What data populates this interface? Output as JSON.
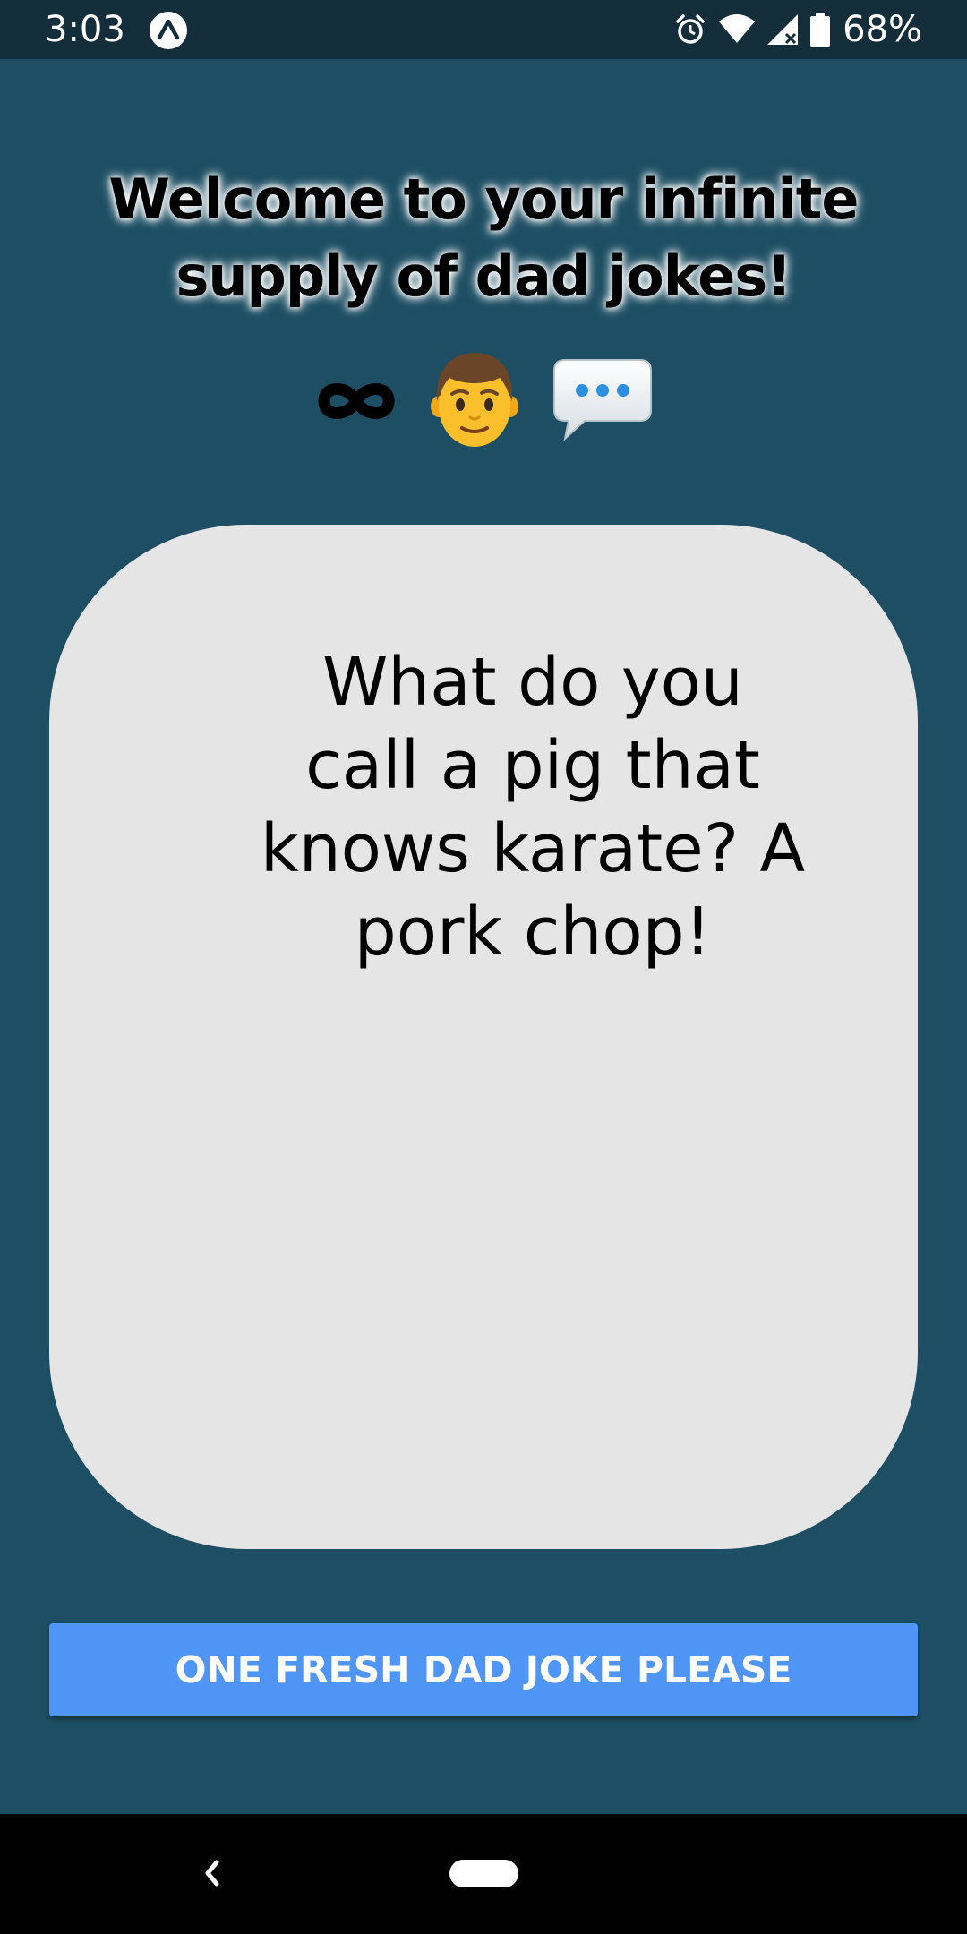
{
  "status_bar": {
    "time": "3:03",
    "battery_percent": "68%",
    "icons": [
      "expo-icon",
      "alarm-icon",
      "wifi-icon",
      "signal-icon",
      "battery-icon"
    ]
  },
  "header": {
    "welcome_line1": "Welcome to your infinite",
    "welcome_line2": "supply of dad jokes!",
    "emoji_icons": [
      "infinity-icon",
      "man-icon",
      "speech-bubble-icon"
    ]
  },
  "joke": {
    "text": "What do you call a pig that knows karate? A pork chop!"
  },
  "actions": {
    "fresh_joke_label": "ONE FRESH DAD JOKE PLEASE"
  },
  "nav": {
    "icons": [
      "back-icon",
      "home-pill"
    ]
  },
  "colors": {
    "background": "#1d4e63",
    "status_bar": "#142d3a",
    "card": "#e5e5e5",
    "button": "#4f95f6",
    "nav_bar": "#000000"
  }
}
